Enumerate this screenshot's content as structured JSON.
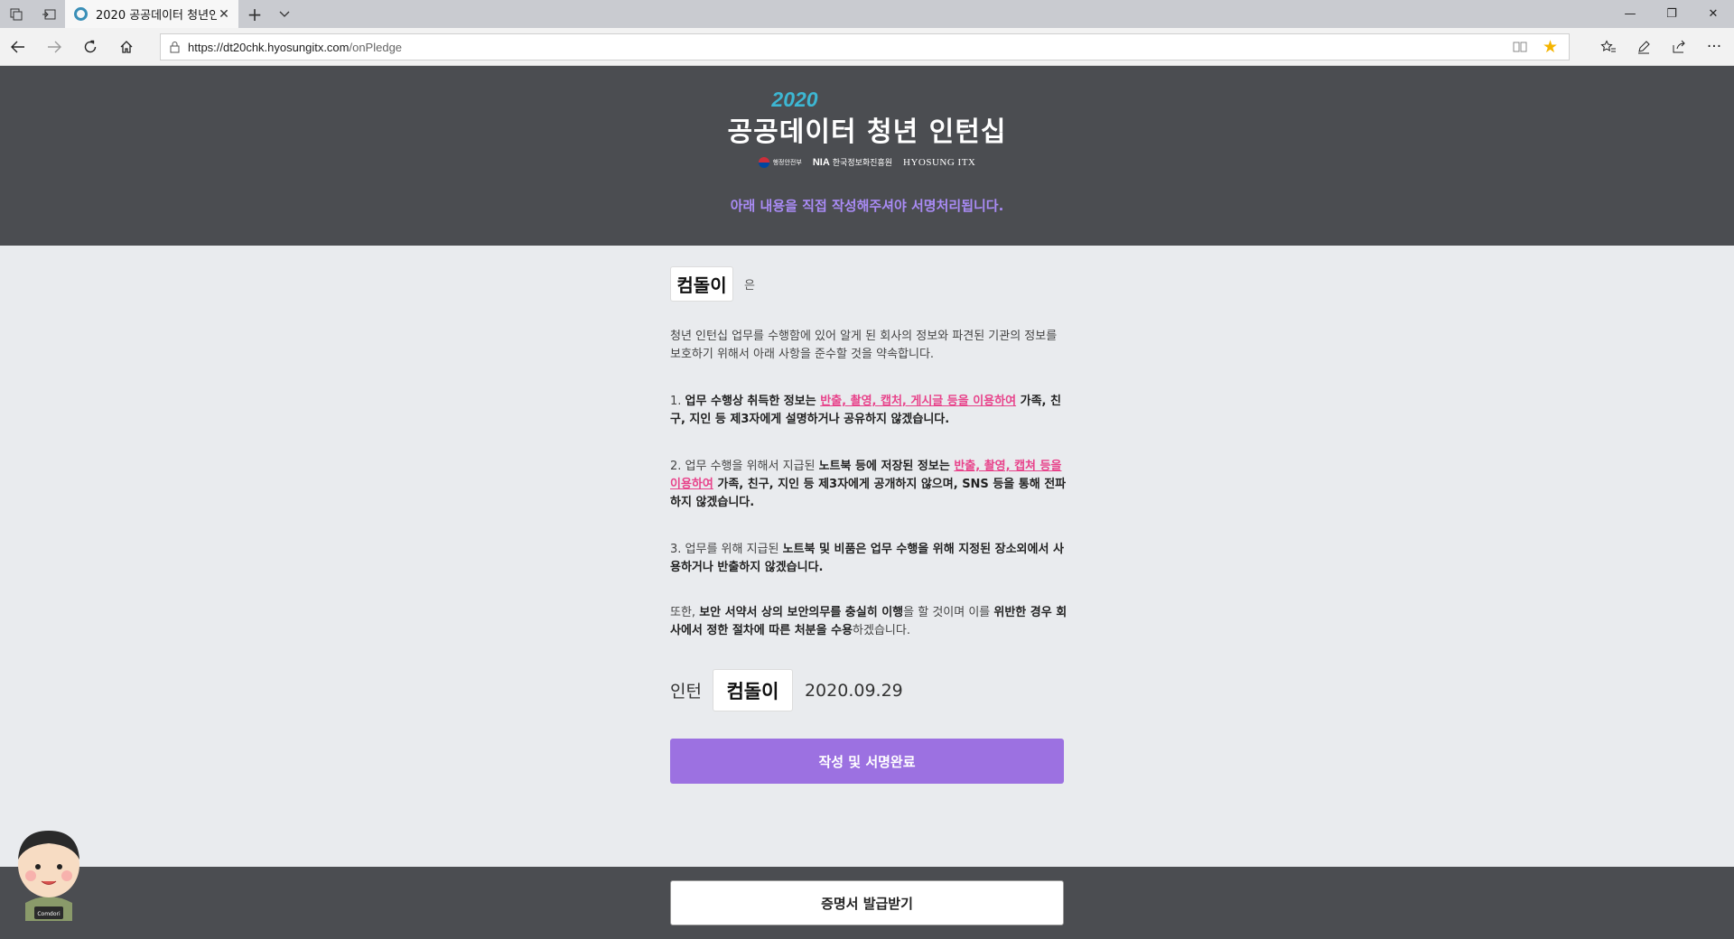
{
  "browser": {
    "tab_title": "2020 공공데이터 청년인",
    "url_host": "https://dt20chk.hyosungitx.com",
    "url_path": "/onPledge"
  },
  "header": {
    "year": "2020",
    "title": "공공데이터 청년 인턴십",
    "logos": {
      "mois": "행정안전부",
      "nia_abbr": "NIA",
      "nia_name": "한국정보화진흥원",
      "hyosung": "HYOSUNG ITX"
    },
    "notice": "아래 내용을 직접 작성해주셔야 서명처리됩니다."
  },
  "pledge": {
    "name": "컴돌이",
    "particle": "은",
    "intro": "청년 인턴십 업무를 수행함에 있어 알게 된 회사의 정보와 파견된 기관의 정보를 보호하기 위해서 아래 사항을 준수할 것을 약속합니다.",
    "item1": {
      "num": "1. ",
      "a": "업무 수행상 취득한 정보는 ",
      "hl": "반출, 촬영, 캡처, 게시글 등을 이용하여",
      "b": " 가족, 친구, 지인 등 제3자에게 설명하거나 공유하지 않겠습니다."
    },
    "item2": {
      "num": "2. 업무 수행을 위해서 지급된 ",
      "a": "노트북 등에 저장된 정보는 ",
      "hl": "반출, 촬영, 캡쳐 등을 이용하여",
      "b": " 가족, 친구, 지인 등 제3자에게 공개하지 않으며, SNS 등을 통해 전파하지 않겠습니다."
    },
    "item3": {
      "num": "3. 업무를 위해 지급된 ",
      "a": "노트북 및 비품은 업무 수행을 위해 지정된 장소외에서 사용하거나 반출하지 않겠습니다."
    },
    "closing": {
      "a": "또한, ",
      "b": "보안 서약서 상의 보안의무를 충실히 이행",
      "c": "을 할 것이며 이를 ",
      "d": "위반한 경우 회사에서 정한 절차에 따른 처분을 수용",
      "e": "하겠습니다."
    },
    "sign_label": "인턴",
    "sign_name": "컴돌이",
    "date": "2020.09.29",
    "submit_label": "작성 및 서명완료"
  },
  "footer": {
    "cert_label": "증명서 발급받기"
  },
  "mascot": {
    "badge": "Comdori"
  }
}
